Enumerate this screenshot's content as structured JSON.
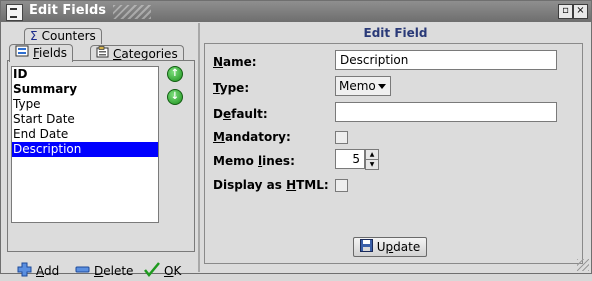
{
  "window": {
    "title": "Edit Fields",
    "minimize_glyph": "▫",
    "close_glyph": "×"
  },
  "tabs": {
    "counters": {
      "label": "Counters",
      "icon": "sigma-icon",
      "glyph": "Σ"
    },
    "fields": {
      "label_pre": "",
      "label_key": "F",
      "label_post": "ields",
      "icon": "fields-icon"
    },
    "categories": {
      "label_pre": "",
      "label_key": "C",
      "label_post": "ategories",
      "icon": "categories-icon"
    }
  },
  "fields_list": {
    "items": [
      {
        "label": "ID",
        "bold": true,
        "selected": false
      },
      {
        "label": "Summary",
        "bold": true,
        "selected": false
      },
      {
        "label": "Type",
        "bold": false,
        "selected": false
      },
      {
        "label": "Start Date",
        "bold": false,
        "selected": false
      },
      {
        "label": "End Date",
        "bold": false,
        "selected": false
      },
      {
        "label": "Description",
        "bold": false,
        "selected": true
      }
    ]
  },
  "buttons": {
    "add": {
      "key": "A",
      "rest": "dd"
    },
    "delete": {
      "key": "D",
      "rest": "elete"
    },
    "ok": {
      "key": "O",
      "rest": "K"
    },
    "update": {
      "pre": "U",
      "key": "p",
      "rest": "date"
    }
  },
  "edit_field": {
    "header": "Edit Field",
    "name_label": {
      "key": "N",
      "rest": "ame:"
    },
    "name_value": "Description",
    "type_label": {
      "key": "T",
      "rest": "ype:"
    },
    "type_value": "Memo",
    "default_label": {
      "pre": "D",
      "key": "e",
      "rest": "fault:"
    },
    "default_value": "",
    "mandatory_label": {
      "key": "M",
      "rest": "andatory:"
    },
    "mandatory_checked": false,
    "memo_lines_label": {
      "pre": "Memo ",
      "key": "l",
      "rest": "ines:"
    },
    "memo_lines_value": "5",
    "display_html_label": {
      "pre": "Display as ",
      "key": "H",
      "rest": "TML:"
    },
    "display_html_checked": false
  },
  "colors": {
    "selection": "#0000ff",
    "header_text": "#2a3a78",
    "titlebar": "#7a7a7a"
  }
}
